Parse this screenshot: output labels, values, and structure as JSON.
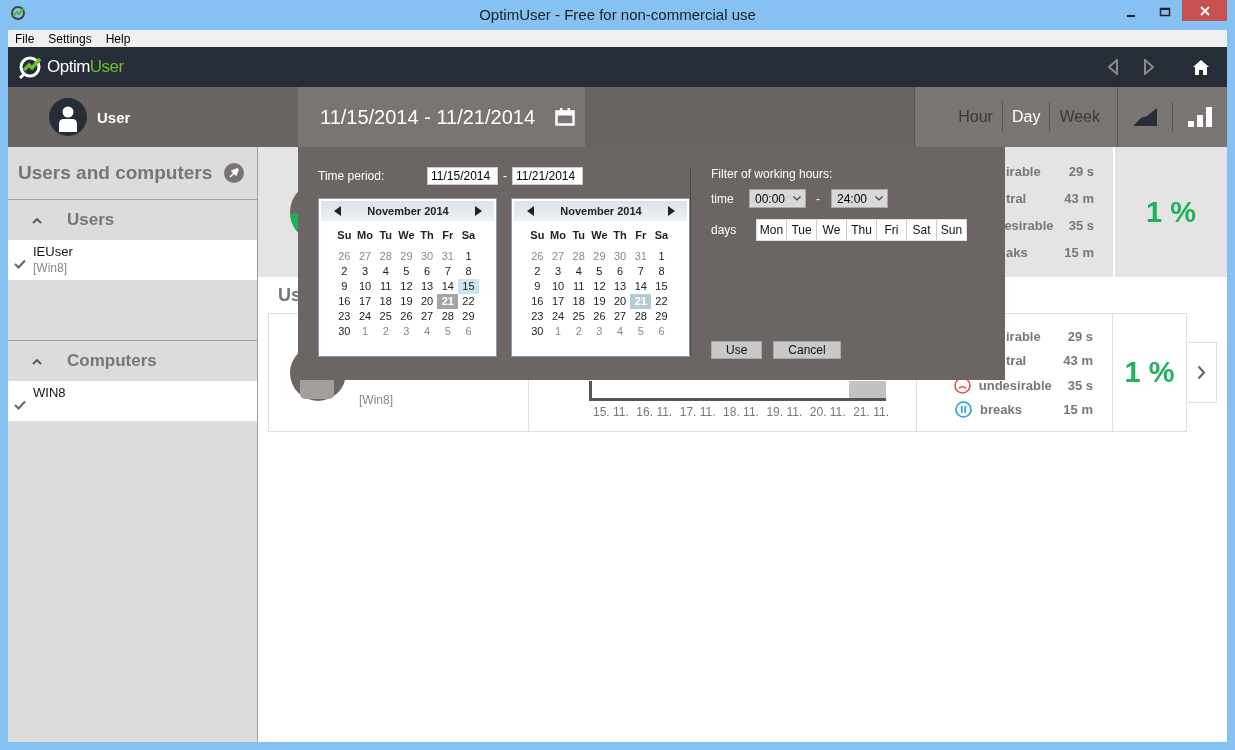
{
  "window": {
    "title": "OptimUser - Free for non-commercial use"
  },
  "menu": [
    "File",
    "Settings",
    "Help"
  ],
  "header": {
    "logo_main": "Optim",
    "logo_accent": "User"
  },
  "user_bar": {
    "user": "User",
    "date_range": "11/15/2014 - 11/21/2014",
    "granularity": [
      {
        "label": "Hour",
        "selected": false
      },
      {
        "label": "Day",
        "selected": true
      },
      {
        "label": "Week",
        "selected": false
      }
    ],
    "views": [
      {
        "kind": "area",
        "selected": false
      },
      {
        "kind": "bars",
        "selected": true
      }
    ]
  },
  "sidebar": {
    "title": "Users and computers",
    "sections": [
      {
        "title": "Users",
        "expanded": true,
        "items": [
          {
            "name": "IEUser",
            "detail": "[Win8]",
            "checked": true
          }
        ]
      },
      {
        "title": "Computers",
        "expanded": true,
        "items": [
          {
            "name": "WIN8",
            "checked": true
          }
        ]
      }
    ]
  },
  "summary": {
    "stats": [
      {
        "label": "irable",
        "value": "29 s"
      },
      {
        "label": "tral",
        "value": "43 m"
      },
      {
        "label": "esirable",
        "value": "35 s"
      },
      {
        "label": "aks",
        "value": "15 m"
      }
    ],
    "percent": "1 %"
  },
  "section_title": "Us",
  "card": {
    "detail": "[Win8]",
    "chart_labels": [
      "15. 11.",
      "16. 11.",
      "17. 11.",
      "18. 11.",
      "19. 11.",
      "20. 11.",
      "21. 11."
    ],
    "stats": [
      {
        "label": "irable",
        "value": "29 s",
        "kind": "plain"
      },
      {
        "label": "tral",
        "value": "43 m",
        "kind": "plain"
      },
      {
        "label": "undesirable",
        "value": "35 s",
        "kind": "sad"
      },
      {
        "label": "breaks",
        "value": "15 m",
        "kind": "pause"
      }
    ],
    "percent": "1 %"
  },
  "popup": {
    "time_period_label": "Time period:",
    "from": "11/15/2014",
    "separator": "-",
    "to": "11/21/2014",
    "calendars": [
      {
        "month": "November 2014",
        "weekdays": [
          "Su",
          "Mo",
          "Tu",
          "We",
          "Th",
          "Fr",
          "Sa"
        ],
        "days": [
          {
            "t": "26",
            "kind": "other"
          },
          {
            "t": "27",
            "kind": "other"
          },
          {
            "t": "28",
            "kind": "other"
          },
          {
            "t": "29",
            "kind": "other"
          },
          {
            "t": "30",
            "kind": "other"
          },
          {
            "t": "31",
            "kind": "other"
          },
          {
            "t": "1",
            "kind": "day"
          },
          {
            "t": "2",
            "kind": "day"
          },
          {
            "t": "3",
            "kind": "day"
          },
          {
            "t": "4",
            "kind": "day"
          },
          {
            "t": "5",
            "kind": "day"
          },
          {
            "t": "6",
            "kind": "day"
          },
          {
            "t": "7",
            "kind": "day"
          },
          {
            "t": "8",
            "kind": "day"
          },
          {
            "t": "9",
            "kind": "day"
          },
          {
            "t": "10",
            "kind": "day"
          },
          {
            "t": "11",
            "kind": "day"
          },
          {
            "t": "12",
            "kind": "day"
          },
          {
            "t": "13",
            "kind": "day"
          },
          {
            "t": "14",
            "kind": "day"
          },
          {
            "t": "15",
            "kind": "selected"
          },
          {
            "t": "16",
            "kind": "day"
          },
          {
            "t": "17",
            "kind": "day"
          },
          {
            "t": "18",
            "kind": "day"
          },
          {
            "t": "19",
            "kind": "day"
          },
          {
            "t": "20",
            "kind": "day"
          },
          {
            "t": "21",
            "kind": "today"
          },
          {
            "t": "22",
            "kind": "day"
          },
          {
            "t": "23",
            "kind": "day"
          },
          {
            "t": "24",
            "kind": "day"
          },
          {
            "t": "25",
            "kind": "day"
          },
          {
            "t": "26",
            "kind": "day"
          },
          {
            "t": "27",
            "kind": "day"
          },
          {
            "t": "28",
            "kind": "day"
          },
          {
            "t": "29",
            "kind": "day"
          },
          {
            "t": "30",
            "kind": "day"
          },
          {
            "t": "1",
            "kind": "other"
          },
          {
            "t": "2",
            "kind": "other"
          },
          {
            "t": "3",
            "kind": "other"
          },
          {
            "t": "4",
            "kind": "other"
          },
          {
            "t": "5",
            "kind": "other"
          },
          {
            "t": "6",
            "kind": "other"
          }
        ]
      },
      {
        "month": "November 2014",
        "weekdays": [
          "Su",
          "Mo",
          "Tu",
          "We",
          "Th",
          "Fr",
          "Sa"
        ],
        "days": [
          {
            "t": "26",
            "kind": "other"
          },
          {
            "t": "27",
            "kind": "other"
          },
          {
            "t": "28",
            "kind": "other"
          },
          {
            "t": "29",
            "kind": "other"
          },
          {
            "t": "30",
            "kind": "other"
          },
          {
            "t": "31",
            "kind": "other"
          },
          {
            "t": "1",
            "kind": "day"
          },
          {
            "t": "2",
            "kind": "day"
          },
          {
            "t": "3",
            "kind": "day"
          },
          {
            "t": "4",
            "kind": "day"
          },
          {
            "t": "5",
            "kind": "day"
          },
          {
            "t": "6",
            "kind": "day"
          },
          {
            "t": "7",
            "kind": "day"
          },
          {
            "t": "8",
            "kind": "day"
          },
          {
            "t": "9",
            "kind": "day"
          },
          {
            "t": "10",
            "kind": "day"
          },
          {
            "t": "11",
            "kind": "day"
          },
          {
            "t": "12",
            "kind": "day"
          },
          {
            "t": "13",
            "kind": "day"
          },
          {
            "t": "14",
            "kind": "day"
          },
          {
            "t": "15",
            "kind": "day"
          },
          {
            "t": "16",
            "kind": "day"
          },
          {
            "t": "17",
            "kind": "day"
          },
          {
            "t": "18",
            "kind": "day"
          },
          {
            "t": "19",
            "kind": "day"
          },
          {
            "t": "20",
            "kind": "day"
          },
          {
            "t": "21",
            "kind": "selected_today"
          },
          {
            "t": "22",
            "kind": "day"
          },
          {
            "t": "23",
            "kind": "day"
          },
          {
            "t": "24",
            "kind": "day"
          },
          {
            "t": "25",
            "kind": "day"
          },
          {
            "t": "26",
            "kind": "day"
          },
          {
            "t": "27",
            "kind": "day"
          },
          {
            "t": "28",
            "kind": "day"
          },
          {
            "t": "29",
            "kind": "day"
          },
          {
            "t": "30",
            "kind": "day"
          },
          {
            "t": "1",
            "kind": "other"
          },
          {
            "t": "2",
            "kind": "other"
          },
          {
            "t": "3",
            "kind": "other"
          },
          {
            "t": "4",
            "kind": "other"
          },
          {
            "t": "5",
            "kind": "other"
          },
          {
            "t": "6",
            "kind": "other"
          }
        ]
      }
    ],
    "filter_label": "Filter of working hours:",
    "time_label": "time",
    "time_from": "00:00",
    "time_separator": "-",
    "time_to": "24:00",
    "days_label": "days",
    "days": [
      {
        "label": "Mon",
        "selected": true
      },
      {
        "label": "Tue",
        "selected": true
      },
      {
        "label": "We",
        "selected": true
      },
      {
        "label": "Thu",
        "selected": true
      },
      {
        "label": "Fri",
        "selected": true
      },
      {
        "label": "Sat",
        "selected": true
      },
      {
        "label": "Sun",
        "selected": true
      }
    ],
    "buttons": [
      "Use",
      "Cancel"
    ]
  }
}
